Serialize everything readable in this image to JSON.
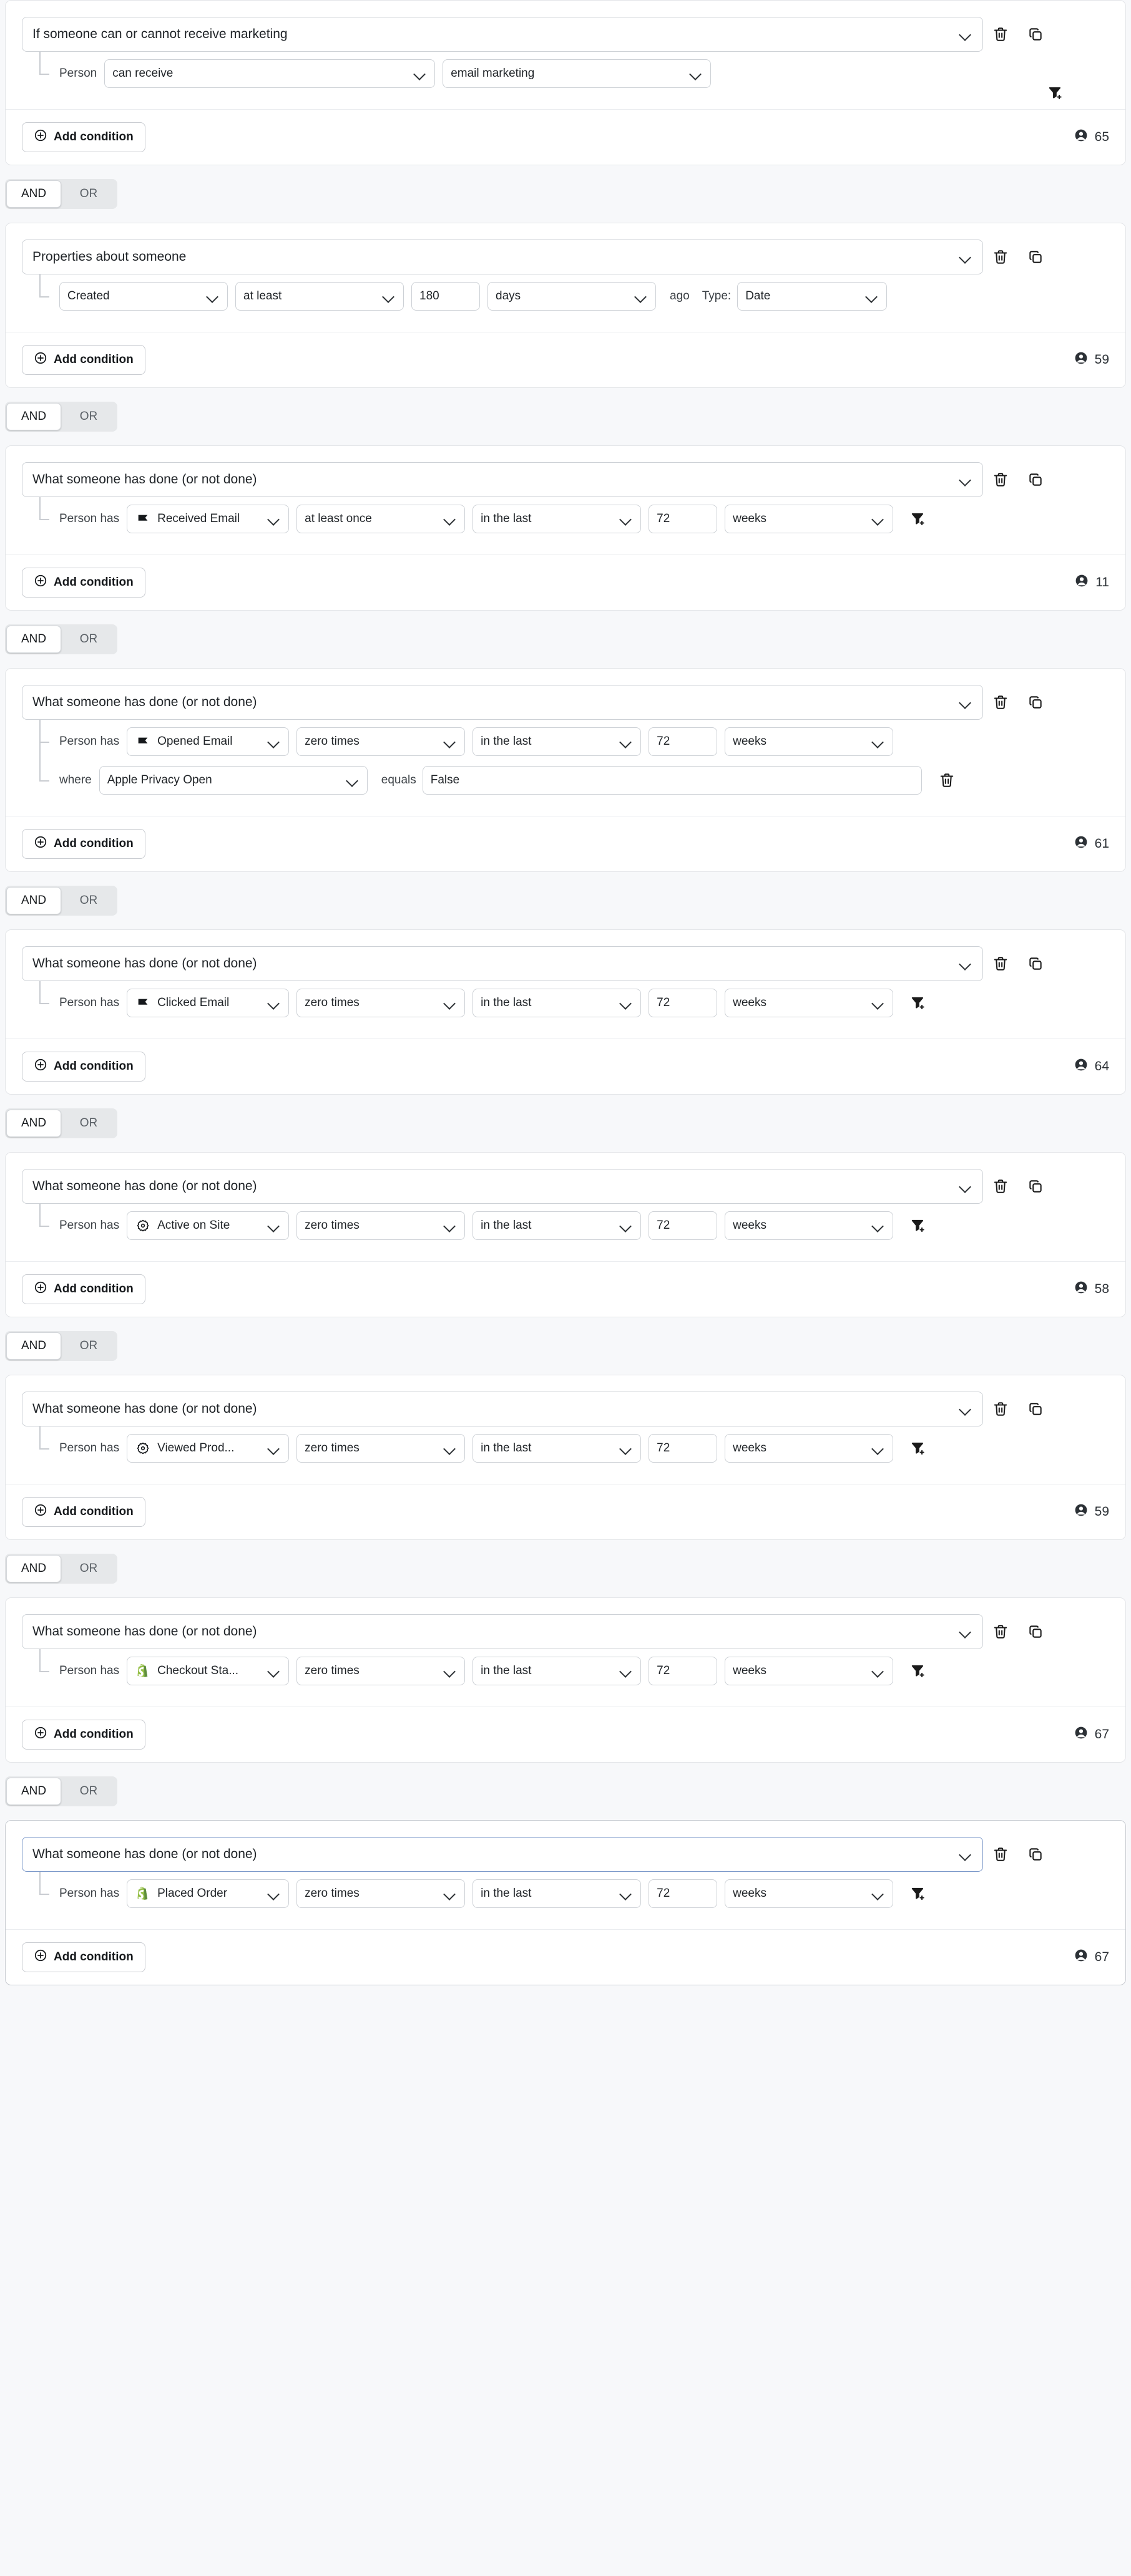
{
  "labels": {
    "add_condition": "Add condition",
    "and": "AND",
    "or": "OR",
    "person": "Person",
    "person_has": "Person has",
    "where": "where",
    "equals": "equals",
    "ago": "ago",
    "type": "Type:"
  },
  "icons": {
    "delete": "trash-icon",
    "duplicate": "duplicate-icon",
    "filter": "add-filter-icon",
    "person": "person-icon",
    "plus_circle": "plus-circle-icon",
    "chevron": "chevron-down-icon",
    "flag": "flag-metric-icon",
    "gear": "gear-metric-icon",
    "shopify": "shopify-metric-icon"
  },
  "colors": {
    "card_border": "#e3e5e8",
    "input_border": "#cdd1d6",
    "focus_border": "#7b98c9",
    "page_bg": "#f7f8fa",
    "shopify_green": "#95bf47",
    "flag_black": "#1a1a1a"
  },
  "groups": [
    {
      "title": "If someone can or cannot receive marketing",
      "focused": false,
      "count": "65",
      "has_filter_icon": true,
      "rows": [
        {
          "kind": "marketing",
          "prefix": "Person",
          "operator": "can receive",
          "channel": "email marketing"
        }
      ]
    },
    {
      "title": "Properties about someone",
      "focused": false,
      "count": "59",
      "has_filter_icon": false,
      "rows": [
        {
          "kind": "property",
          "attribute": "Created",
          "operator": "at least",
          "number": "180",
          "unit": "days",
          "ago": "ago",
          "type_label": "Type:",
          "type_value": "Date"
        }
      ]
    },
    {
      "title": "What someone has done (or not done)",
      "focused": false,
      "count": "11",
      "has_filter_icon": true,
      "rows": [
        {
          "kind": "metric",
          "prefix": "Person has",
          "metric_icon": "flag",
          "metric": "Received Email",
          "frequency": "at least once",
          "timeframe": "in the last",
          "number": "72",
          "unit": "weeks"
        }
      ]
    },
    {
      "title": "What someone has done (or not done)",
      "focused": false,
      "count": "61",
      "has_filter_icon": false,
      "rows": [
        {
          "kind": "metric",
          "prefix": "Person has",
          "metric_icon": "flag",
          "metric": "Opened Email",
          "frequency": "zero times",
          "timeframe": "in the last",
          "number": "72",
          "unit": "weeks",
          "timeframe_focused": true
        },
        {
          "kind": "where",
          "where_label": "where",
          "property": "Apple Privacy Open",
          "equals_label": "equals",
          "value": "False"
        }
      ]
    },
    {
      "title": "What someone has done (or not done)",
      "focused": false,
      "count": "64",
      "has_filter_icon": true,
      "rows": [
        {
          "kind": "metric",
          "prefix": "Person has",
          "metric_icon": "flag",
          "metric": "Clicked Email",
          "frequency": "zero times",
          "timeframe": "in the last",
          "number": "72",
          "unit": "weeks"
        }
      ]
    },
    {
      "title": "What someone has done (or not done)",
      "focused": false,
      "count": "58",
      "has_filter_icon": true,
      "rows": [
        {
          "kind": "metric",
          "prefix": "Person has",
          "metric_icon": "gear",
          "metric": "Active on Site",
          "frequency": "zero times",
          "timeframe": "in the last",
          "number": "72",
          "unit": "weeks"
        }
      ]
    },
    {
      "title": "What someone has done (or not done)",
      "focused": false,
      "count": "59",
      "has_filter_icon": true,
      "rows": [
        {
          "kind": "metric",
          "prefix": "Person has",
          "metric_icon": "gear",
          "metric": "Viewed Prod...",
          "frequency": "zero times",
          "timeframe": "in the last",
          "number": "72",
          "unit": "weeks"
        }
      ]
    },
    {
      "title": "What someone has done (or not done)",
      "focused": false,
      "count": "67",
      "has_filter_icon": true,
      "rows": [
        {
          "kind": "metric",
          "prefix": "Person has",
          "metric_icon": "shopify",
          "metric": "Checkout Sta...",
          "frequency": "zero times",
          "timeframe": "in the last",
          "number": "72",
          "unit": "weeks"
        }
      ]
    },
    {
      "title": "What someone has done (or not done)",
      "focused": true,
      "count": "67",
      "has_filter_icon": true,
      "rows": [
        {
          "kind": "metric",
          "prefix": "Person has",
          "metric_icon": "shopify",
          "metric": "Placed Order",
          "frequency": "zero times",
          "timeframe": "in the last",
          "number": "72",
          "unit": "weeks"
        }
      ]
    }
  ],
  "separators": [
    {
      "selected": "AND"
    },
    {
      "selected": "AND"
    },
    {
      "selected": "AND"
    },
    {
      "selected": "AND"
    },
    {
      "selected": "AND"
    },
    {
      "selected": "AND"
    },
    {
      "selected": "AND"
    },
    {
      "selected": "AND"
    }
  ]
}
